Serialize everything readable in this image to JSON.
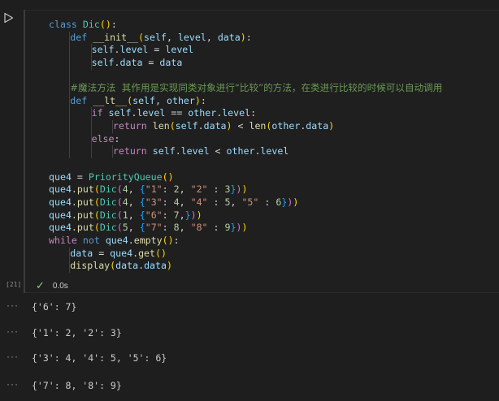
{
  "cell": {
    "execution_count": "[21]",
    "status_time": "0.0s",
    "code_lines": [
      [
        {
          "c": "kw",
          "t": "class "
        },
        {
          "c": "cls",
          "t": "Dic"
        },
        {
          "c": "p1",
          "t": "()"
        },
        {
          "c": "op",
          "t": ":"
        }
      ],
      [
        {
          "c": "kw",
          "t": "def "
        },
        {
          "c": "fn",
          "t": "__init__"
        },
        {
          "c": "p1",
          "t": "("
        },
        {
          "c": "var",
          "t": "self"
        },
        {
          "c": "op",
          "t": ", "
        },
        {
          "c": "var",
          "t": "level"
        },
        {
          "c": "op",
          "t": ", "
        },
        {
          "c": "var",
          "t": "data"
        },
        {
          "c": "p1",
          "t": ")"
        },
        {
          "c": "op",
          "t": ":"
        }
      ],
      [
        {
          "c": "var",
          "t": "self"
        },
        {
          "c": "op",
          "t": "."
        },
        {
          "c": "var",
          "t": "level"
        },
        {
          "c": "op",
          "t": " = "
        },
        {
          "c": "var",
          "t": "level"
        }
      ],
      [
        {
          "c": "var",
          "t": "self"
        },
        {
          "c": "op",
          "t": "."
        },
        {
          "c": "var",
          "t": "data"
        },
        {
          "c": "op",
          "t": " = "
        },
        {
          "c": "var",
          "t": "data"
        }
      ],
      [],
      [
        {
          "c": "cm",
          "t": "#魔法方法  其作用是实现同类对象进行“比较”的方法，在类进行比较的时候可以自动调用"
        }
      ],
      [
        {
          "c": "kw",
          "t": "def "
        },
        {
          "c": "fn",
          "t": "__lt__"
        },
        {
          "c": "p1",
          "t": "("
        },
        {
          "c": "var",
          "t": "self"
        },
        {
          "c": "op",
          "t": ", "
        },
        {
          "c": "var",
          "t": "other"
        },
        {
          "c": "p1",
          "t": ")"
        },
        {
          "c": "op",
          "t": ":"
        }
      ],
      [
        {
          "c": "kc",
          "t": "if "
        },
        {
          "c": "var",
          "t": "self"
        },
        {
          "c": "op",
          "t": "."
        },
        {
          "c": "var",
          "t": "level"
        },
        {
          "c": "op",
          "t": " == "
        },
        {
          "c": "var",
          "t": "other"
        },
        {
          "c": "op",
          "t": "."
        },
        {
          "c": "var",
          "t": "level"
        },
        {
          "c": "op",
          "t": ":"
        }
      ],
      [
        {
          "c": "kc",
          "t": "return "
        },
        {
          "c": "fn",
          "t": "len"
        },
        {
          "c": "p1",
          "t": "("
        },
        {
          "c": "var",
          "t": "self"
        },
        {
          "c": "op",
          "t": "."
        },
        {
          "c": "var",
          "t": "data"
        },
        {
          "c": "p1",
          "t": ")"
        },
        {
          "c": "op",
          "t": " < "
        },
        {
          "c": "fn",
          "t": "len"
        },
        {
          "c": "p1",
          "t": "("
        },
        {
          "c": "var",
          "t": "other"
        },
        {
          "c": "op",
          "t": "."
        },
        {
          "c": "var",
          "t": "data"
        },
        {
          "c": "p1",
          "t": ")"
        }
      ],
      [
        {
          "c": "kc",
          "t": "else"
        },
        {
          "c": "op",
          "t": ":"
        }
      ],
      [
        {
          "c": "kc",
          "t": "return "
        },
        {
          "c": "var",
          "t": "self"
        },
        {
          "c": "op",
          "t": "."
        },
        {
          "c": "var",
          "t": "level"
        },
        {
          "c": "op",
          "t": " < "
        },
        {
          "c": "var",
          "t": "other"
        },
        {
          "c": "op",
          "t": "."
        },
        {
          "c": "var",
          "t": "level"
        }
      ],
      [],
      [
        {
          "c": "var",
          "t": "que4"
        },
        {
          "c": "op",
          "t": " = "
        },
        {
          "c": "cls",
          "t": "PriorityQueue"
        },
        {
          "c": "p1",
          "t": "()"
        }
      ],
      [
        {
          "c": "var",
          "t": "que4"
        },
        {
          "c": "op",
          "t": "."
        },
        {
          "c": "fn",
          "t": "put"
        },
        {
          "c": "p1",
          "t": "("
        },
        {
          "c": "cls",
          "t": "Dic"
        },
        {
          "c": "p2",
          "t": "("
        },
        {
          "c": "num",
          "t": "4"
        },
        {
          "c": "op",
          "t": ", "
        },
        {
          "c": "p3",
          "t": "{"
        },
        {
          "c": "str",
          "t": "\"1\""
        },
        {
          "c": "op",
          "t": ": "
        },
        {
          "c": "num",
          "t": "2"
        },
        {
          "c": "op",
          "t": ", "
        },
        {
          "c": "str",
          "t": "\"2\""
        },
        {
          "c": "op",
          "t": " : "
        },
        {
          "c": "num",
          "t": "3"
        },
        {
          "c": "p3",
          "t": "}"
        },
        {
          "c": "p2",
          "t": ")"
        },
        {
          "c": "p1",
          "t": ")"
        }
      ],
      [
        {
          "c": "var",
          "t": "que4"
        },
        {
          "c": "op",
          "t": "."
        },
        {
          "c": "fn",
          "t": "put"
        },
        {
          "c": "p1",
          "t": "("
        },
        {
          "c": "cls",
          "t": "Dic"
        },
        {
          "c": "p2",
          "t": "("
        },
        {
          "c": "num",
          "t": "4"
        },
        {
          "c": "op",
          "t": ", "
        },
        {
          "c": "p3",
          "t": "{"
        },
        {
          "c": "str",
          "t": "\"3\""
        },
        {
          "c": "op",
          "t": ": "
        },
        {
          "c": "num",
          "t": "4"
        },
        {
          "c": "op",
          "t": ", "
        },
        {
          "c": "str",
          "t": "\"4\""
        },
        {
          "c": "op",
          "t": " : "
        },
        {
          "c": "num",
          "t": "5"
        },
        {
          "c": "op",
          "t": ", "
        },
        {
          "c": "str",
          "t": "\"5\""
        },
        {
          "c": "op",
          "t": " : "
        },
        {
          "c": "num",
          "t": "6"
        },
        {
          "c": "p3",
          "t": "}"
        },
        {
          "c": "p2",
          "t": ")"
        },
        {
          "c": "p1",
          "t": ")"
        }
      ],
      [
        {
          "c": "var",
          "t": "que4"
        },
        {
          "c": "op",
          "t": "."
        },
        {
          "c": "fn",
          "t": "put"
        },
        {
          "c": "p1",
          "t": "("
        },
        {
          "c": "cls",
          "t": "Dic"
        },
        {
          "c": "p2",
          "t": "("
        },
        {
          "c": "num",
          "t": "1"
        },
        {
          "c": "op",
          "t": ", "
        },
        {
          "c": "p3",
          "t": "{"
        },
        {
          "c": "str",
          "t": "\"6\""
        },
        {
          "c": "op",
          "t": ": "
        },
        {
          "c": "num",
          "t": "7"
        },
        {
          "c": "op",
          "t": ","
        },
        {
          "c": "p3",
          "t": "}"
        },
        {
          "c": "p2",
          "t": ")"
        },
        {
          "c": "p1",
          "t": ")"
        }
      ],
      [
        {
          "c": "var",
          "t": "que4"
        },
        {
          "c": "op",
          "t": "."
        },
        {
          "c": "fn",
          "t": "put"
        },
        {
          "c": "p1",
          "t": "("
        },
        {
          "c": "cls",
          "t": "Dic"
        },
        {
          "c": "p2",
          "t": "("
        },
        {
          "c": "num",
          "t": "5"
        },
        {
          "c": "op",
          "t": ", "
        },
        {
          "c": "p3",
          "t": "{"
        },
        {
          "c": "str",
          "t": "\"7\""
        },
        {
          "c": "op",
          "t": ": "
        },
        {
          "c": "num",
          "t": "8"
        },
        {
          "c": "op",
          "t": ", "
        },
        {
          "c": "str",
          "t": "\"8\""
        },
        {
          "c": "op",
          "t": " : "
        },
        {
          "c": "num",
          "t": "9"
        },
        {
          "c": "p3",
          "t": "}"
        },
        {
          "c": "p2",
          "t": ")"
        },
        {
          "c": "p1",
          "t": ")"
        }
      ],
      [
        {
          "c": "kc",
          "t": "while "
        },
        {
          "c": "kw",
          "t": "not "
        },
        {
          "c": "var",
          "t": "que4"
        },
        {
          "c": "op",
          "t": "."
        },
        {
          "c": "fn",
          "t": "empty"
        },
        {
          "c": "p1",
          "t": "()"
        },
        {
          "c": "op",
          "t": ":"
        }
      ],
      [
        {
          "c": "var",
          "t": "data"
        },
        {
          "c": "op",
          "t": " = "
        },
        {
          "c": "var",
          "t": "que4"
        },
        {
          "c": "op",
          "t": "."
        },
        {
          "c": "fn",
          "t": "get"
        },
        {
          "c": "p1",
          "t": "()"
        }
      ],
      [
        {
          "c": "fn",
          "t": "display"
        },
        {
          "c": "p1",
          "t": "("
        },
        {
          "c": "var",
          "t": "data"
        },
        {
          "c": "op",
          "t": "."
        },
        {
          "c": "var",
          "t": "data"
        },
        {
          "c": "p1",
          "t": ")"
        }
      ]
    ],
    "indents": [
      0,
      1,
      2,
      2,
      1,
      1,
      1,
      2,
      3,
      2,
      3,
      0,
      0,
      0,
      0,
      0,
      0,
      0,
      1,
      1
    ]
  },
  "outputs": [
    {
      "more": "···",
      "text": "{'6': 7}"
    },
    {
      "more": "···",
      "text": "{'1': 2, '2': 3}"
    },
    {
      "more": "···",
      "text": "{'3': 4, '4': 5, '5': 6}"
    },
    {
      "more": "···",
      "text": "{'7': 8, '8': 9}"
    }
  ]
}
